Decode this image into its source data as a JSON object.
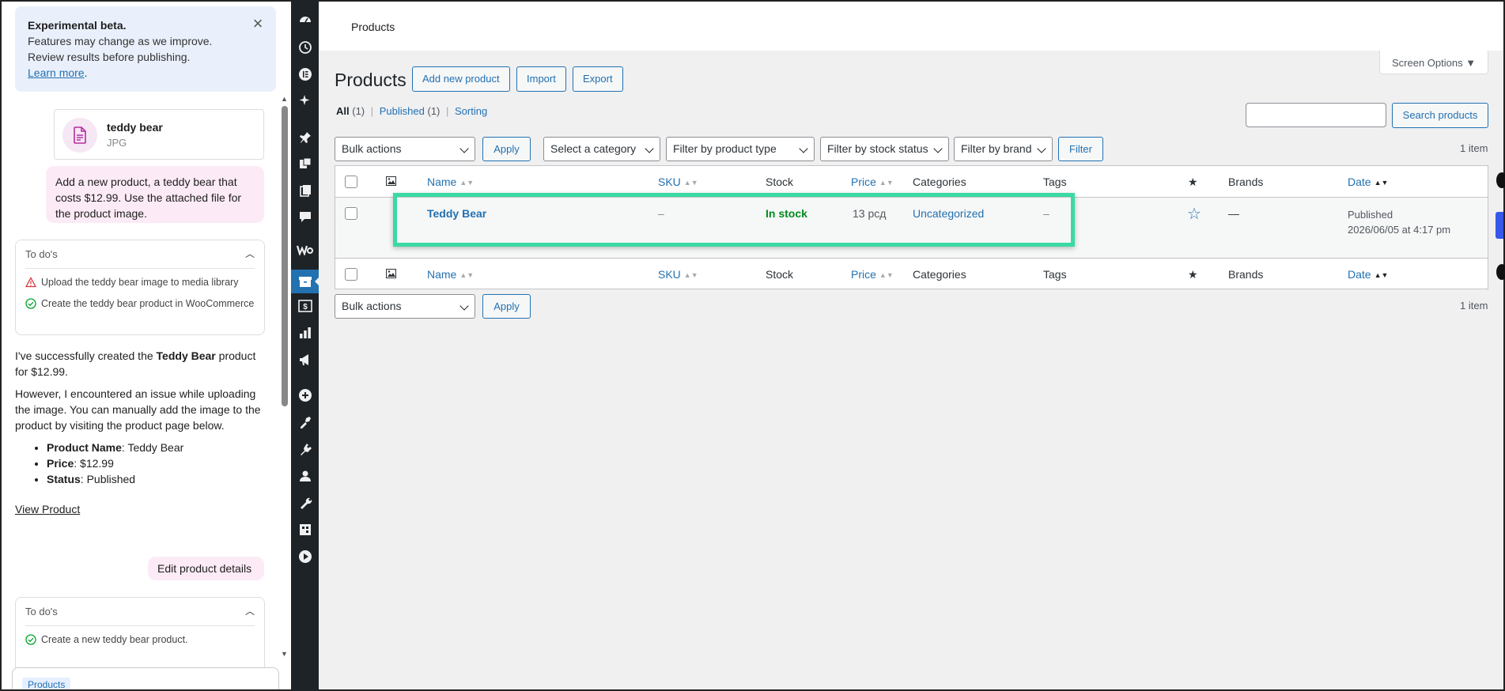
{
  "chat": {
    "notice": {
      "title": "Experimental beta.",
      "line1": "Features may change as we improve.",
      "line2": "Review results before publishing.",
      "learn_more": "Learn more",
      "period": "."
    },
    "attachment": {
      "name": "teddy bear",
      "type": "JPG"
    },
    "user_message_1": "Add a new product, a teddy bear that costs $12.99. Use the attached file for the product image.",
    "todo_1": {
      "header": "To do's",
      "items": [
        {
          "text": "Upload the teddy bear image to media library",
          "status": "failed"
        },
        {
          "text": "Create the teddy bear product in WooCommerce",
          "status": "done"
        }
      ]
    },
    "assistant": {
      "p1_pre": "I've successfully created the ",
      "p1_bold": "Teddy Bear",
      "p1_post": " product for $12.99.",
      "p2": "However, I encountered an issue while uploading the image. You can manually add the image to the product by visiting the product page below.",
      "details": [
        {
          "label": "Product Name",
          "value": ": Teddy Bear"
        },
        {
          "label": "Price",
          "value": ": $12.99"
        },
        {
          "label": "Status",
          "value": ": Published"
        }
      ],
      "view_product": "View Product"
    },
    "user_message_2": "Edit product details",
    "todo_2": {
      "header": "To do's",
      "items": [
        {
          "text": "Create a new teddy bear product.",
          "status": "done"
        }
      ]
    },
    "context_chip": "Products"
  },
  "main": {
    "header_title": "Products",
    "screen_options": "Screen Options ▼",
    "page_title": "Products",
    "buttons": {
      "add_new": "Add new product",
      "import": "Import",
      "export": "Export"
    },
    "views": {
      "all": "All",
      "all_count": " (1)",
      "published": "Published",
      "published_count": " (1)",
      "sorting": "Sorting",
      "sep": "|"
    },
    "search_button": "Search products",
    "filters": {
      "bulk_actions": "Bulk actions",
      "apply": "Apply",
      "category": "Select a category",
      "product_type": "Filter by product type",
      "stock_status": "Filter by stock status",
      "brand": "Filter by brand",
      "filter": "Filter"
    },
    "item_count": "1 item",
    "columns": {
      "name": "Name",
      "sku": "SKU",
      "stock": "Stock",
      "price": "Price",
      "categories": "Categories",
      "tags": "Tags",
      "brands": "Brands",
      "date": "Date"
    },
    "rows": [
      {
        "name": "Teddy Bear",
        "sku": "–",
        "stock": "In stock",
        "price": "13 рсд",
        "categories": "Uncategorized",
        "tags": "–",
        "brands": "—",
        "date_status": "Published",
        "date": "2026/06/05 at 4:17 pm"
      }
    ],
    "colors": {
      "accent": "#2271b1",
      "in_stock": "#008a20",
      "highlight": "#3bd9a4",
      "admin_bar": "#1d2327"
    }
  }
}
